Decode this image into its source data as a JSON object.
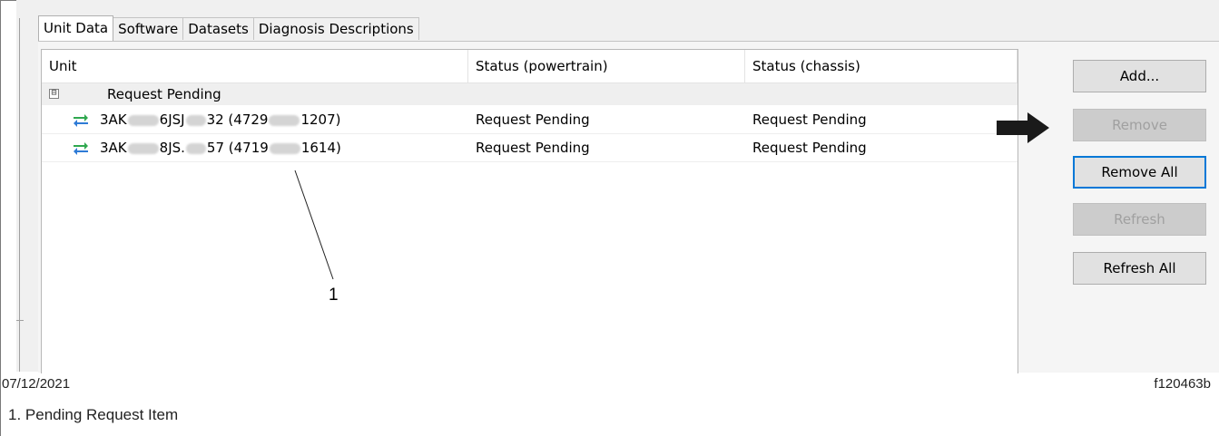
{
  "tabs": [
    {
      "label": "Unit Data",
      "active": true
    },
    {
      "label": "Software",
      "active": false
    },
    {
      "label": "Datasets",
      "active": false
    },
    {
      "label": "Diagnosis Descriptions",
      "active": false
    }
  ],
  "table": {
    "columns": [
      "Unit",
      "Status (powertrain)",
      "Status (chassis)"
    ],
    "group": {
      "expander": "⊟",
      "label": "Request Pending"
    },
    "rows": [
      {
        "unit_a": "3AK",
        "unit_b": "6JSJ",
        "unit_c": "32 (4729",
        "unit_d": "1207)",
        "powertrain": "Request Pending",
        "chassis": "Request Pending"
      },
      {
        "unit_a": "3AK",
        "unit_b": "8JS.",
        "unit_c": "57 (4719",
        "unit_d": "1614)",
        "powertrain": "Request Pending",
        "chassis": "Request Pending"
      }
    ]
  },
  "buttons": {
    "add": "Add...",
    "remove": "Remove",
    "remove_all": "Remove All",
    "refresh": "Refresh",
    "refresh_all": "Refresh All"
  },
  "callout": {
    "number": "1"
  },
  "footer": {
    "date": "07/12/2021",
    "figure_id": "f120463b"
  },
  "caption": "1.  Pending Request Item",
  "colors": {
    "accent_focus": "#0078d7",
    "sync_green": "#2fa84f",
    "sync_blue": "#2e7bd6"
  }
}
